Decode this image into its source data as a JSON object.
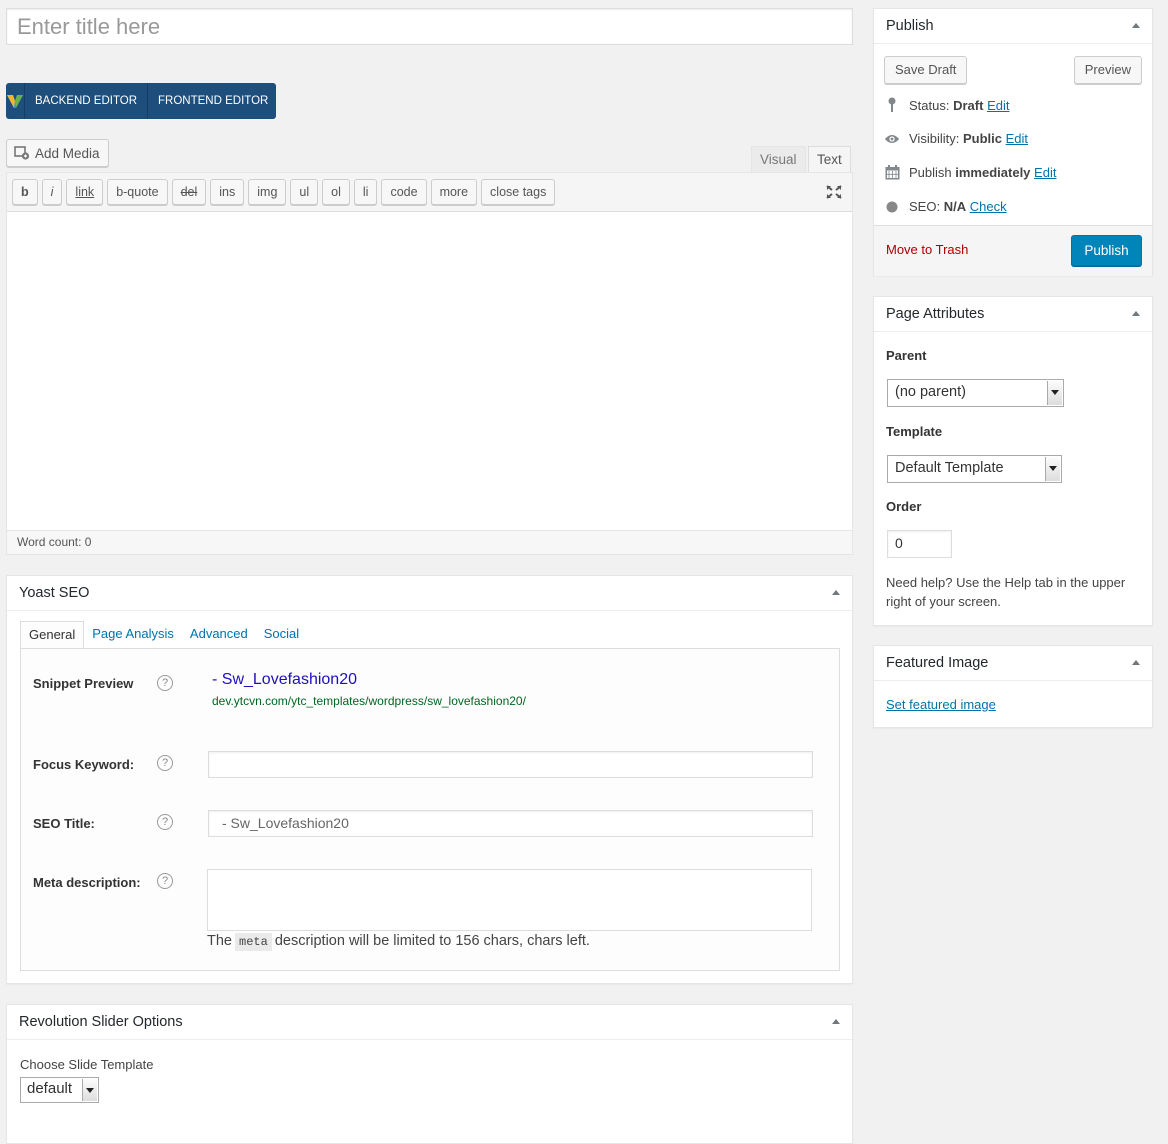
{
  "title_field": {
    "placeholder": "Enter title here"
  },
  "vc_editor": {
    "backend_label": "BACKEND EDITOR",
    "frontend_label": "FRONTEND EDITOR"
  },
  "media": {
    "add_media_label": "Add Media"
  },
  "editor_tabs": {
    "visual": "Visual",
    "text": "Text"
  },
  "quicktags": [
    "b",
    "i",
    "link",
    "b-quote",
    "del",
    "ins",
    "img",
    "ul",
    "ol",
    "li",
    "code",
    "more",
    "close tags"
  ],
  "word_count": "Word count: 0",
  "yoast": {
    "title": "Yoast SEO",
    "tabs": [
      "General",
      "Page Analysis",
      "Advanced",
      "Social"
    ],
    "snippet_label": "Snippet Preview",
    "snippet_title": "- Sw_Lovefashion20",
    "snippet_url": "dev.ytcvn.com/ytc_templates/wordpress/sw_lovefashion20/",
    "focus_label": "Focus Keyword:",
    "focus_value": "",
    "seo_title_label": "SEO Title:",
    "seo_title_value": "- Sw_Lovefashion20",
    "meta_label": "Meta description:",
    "meta_note_pre": "The",
    "meta_note_code": "meta",
    "meta_note_post": "description will be limited to 156 chars, chars left.",
    "help_glyph": "?"
  },
  "revslider": {
    "title": "Revolution Slider Options",
    "choose_label": "Choose Slide Template",
    "selected": "default"
  },
  "publish": {
    "title": "Publish",
    "save_draft": "Save Draft",
    "preview": "Preview",
    "status_label": "Status:",
    "status_value": "Draft",
    "visibility_label": "Visibility:",
    "visibility_value": "Public",
    "publish_label": "Publish",
    "publish_value": "immediately",
    "seo_label": "SEO:",
    "seo_value": "N/A",
    "edit": "Edit",
    "check": "Check",
    "trash": "Move to Trash",
    "publish_button": "Publish"
  },
  "page_attributes": {
    "title": "Page Attributes",
    "parent_label": "Parent",
    "parent_value": "(no parent)",
    "template_label": "Template",
    "template_value": "Default Template",
    "order_label": "Order",
    "order_value": "0",
    "help": "Need help? Use the Help tab in the upper right of your screen."
  },
  "featured_image": {
    "title": "Featured Image",
    "link": "Set featured image"
  },
  "colors": {
    "vc_bar": "#1d4e7c",
    "primary_button": "#0085ba",
    "link": "#0073aa",
    "trash": "#aa0000",
    "snippet_title": "#1e0fbe",
    "snippet_url": "#006621"
  }
}
